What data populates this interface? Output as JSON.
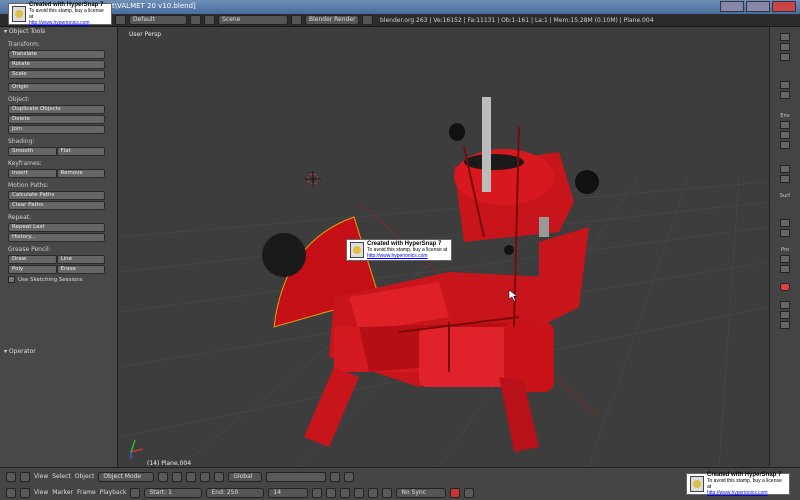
{
  "window": {
    "title": "lt\\VALMET 20 v10.blend]"
  },
  "stamp": {
    "line1": "Created with HyperSnap 7",
    "line2": "To avoid this stamp, buy a license at",
    "line3": "http://www.hyperionics.com"
  },
  "infobar": {
    "layout": "Default",
    "scene": "Scene",
    "engine": "Blender Render",
    "stats": "blender.org 263 | Ve:16152 | Fa:11131 | Ob:1-161 | La:1 | Mem:15.28M (0.10M) | Plane.004"
  },
  "toolshelf": {
    "header": "Object Tools",
    "transform_label": "Transform:",
    "translate": "Translate",
    "rotate": "Rotate",
    "scale": "Scale",
    "origin": "Origin",
    "object_label": "Object:",
    "duplicate": "Duplicate Objects",
    "delete": "Delete",
    "join": "Join",
    "shading_label": "Shading:",
    "smooth": "Smooth",
    "flat": "Flat",
    "keyframes_label": "Keyframes:",
    "insert": "Insert",
    "remove": "Remove",
    "motion_label": "Motion Paths:",
    "calc_paths": "Calculate Paths",
    "clear_paths": "Clear Paths",
    "repeat_label": "Repeat:",
    "repeat_last": "Repeat Last",
    "history": "History...",
    "grease_label": "Grease Pencil:",
    "draw": "Draw",
    "line": "Line",
    "poly": "Poly",
    "erase": "Erase",
    "sketch_sessions": "Use Sketching Sessions",
    "operator": "Operator"
  },
  "viewport": {
    "view_label": "User Persp",
    "object_label": "(14) Plane.004"
  },
  "props": {
    "env": "Env",
    "surf": "Surf",
    "pro": "Pro"
  },
  "viewport_header": {
    "view": "View",
    "select": "Select",
    "object": "Object",
    "mode": "Object Mode",
    "orientation": "Global"
  },
  "timeline": {
    "view": "View",
    "marker": "Marker",
    "frame": "Frame",
    "playback": "Playback",
    "start": "Start: 1",
    "end": "End: 250",
    "current": "14",
    "sync": "No Sync"
  },
  "colors": {
    "tractor_red": "#d4121a",
    "viewport_bg": "#3d3d3d"
  }
}
